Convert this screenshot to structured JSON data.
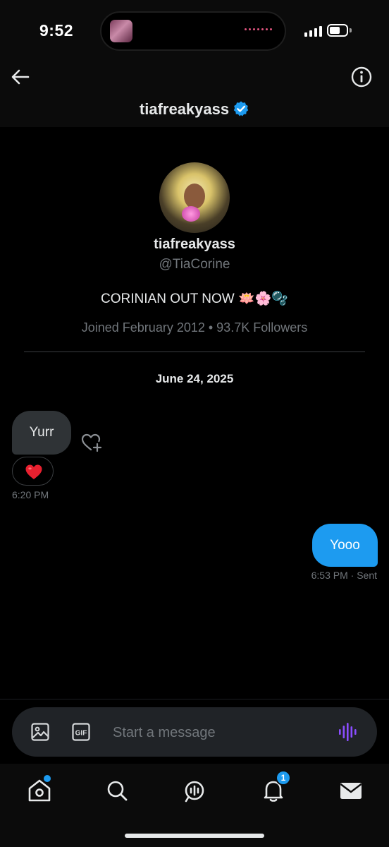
{
  "status_bar": {
    "time": "9:52"
  },
  "header": {
    "title": "tiafreakyass"
  },
  "profile": {
    "name": "tiafreakyass",
    "handle": "@TiaCorine",
    "bio": "CORINIAN OUT NOW 🪷🌸🫧",
    "meta": "Joined February 2012 • 93.7K Followers"
  },
  "conversation": {
    "date": "June 24, 2025",
    "messages": [
      {
        "direction": "incoming",
        "text": "Yurr",
        "reaction": "❤️",
        "time": "6:20 PM"
      },
      {
        "direction": "outgoing",
        "text": "Yooo",
        "time": "6:53 PM · Sent"
      }
    ]
  },
  "composer": {
    "placeholder": "Start a message"
  },
  "bottom_nav": {
    "notification_count": "1"
  },
  "colors": {
    "accent": "#1d9bf0",
    "background": "#000000",
    "incoming_bubble": "#2f3336",
    "voice_icon": "#8a4dff"
  },
  "icons": [
    "back-arrow-icon",
    "info-icon",
    "verified-badge-icon",
    "add-reaction-icon",
    "heart-icon",
    "image-icon",
    "gif-icon",
    "voice-icon",
    "home-icon",
    "search-icon",
    "spaces-icon",
    "bell-icon",
    "mail-icon"
  ]
}
